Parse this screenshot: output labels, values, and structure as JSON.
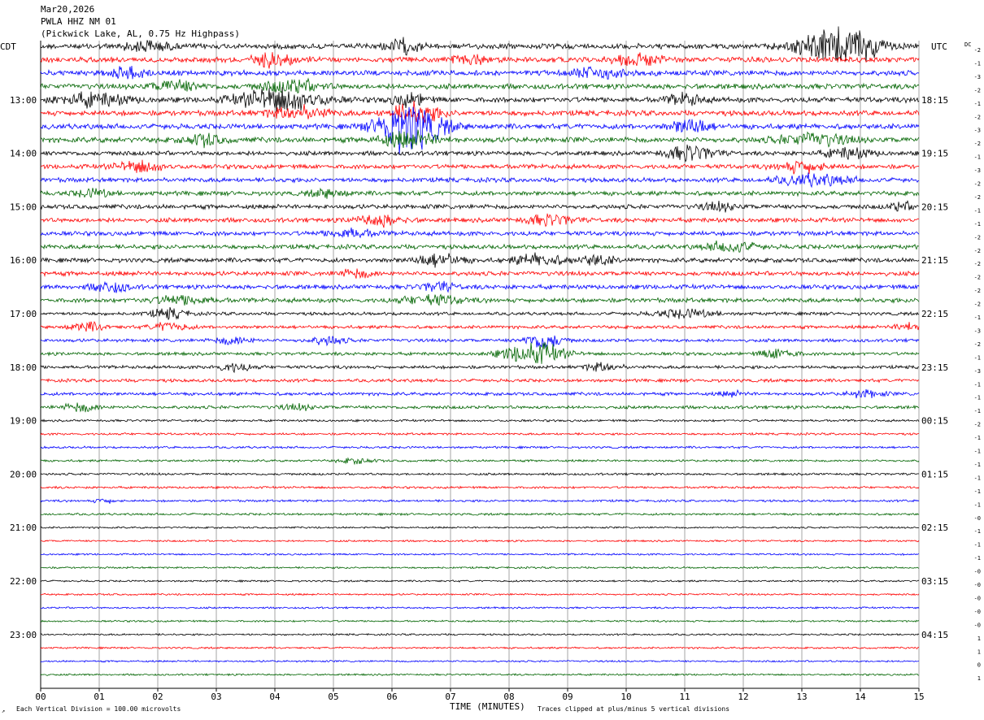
{
  "header": {
    "date": "Mar20,2026",
    "station": "PWLA HHZ NM 01",
    "location": "(Pickwick Lake, AL, 0.75 Hz Highpass)"
  },
  "left_tz": "CDT",
  "right_tz": "UTC",
  "dc_label": "DC",
  "footer": {
    "scale": "Each Vertical Division =  100.00 microvolts",
    "xlabel": "TIME (MINUTES)",
    "clip": "Traces clipped at plus/minus 5 vertical divisions"
  },
  "colors": {
    "trace": [
      "#000000",
      "#ff0000",
      "#0000ff",
      "#006400"
    ],
    "grid": "#808080"
  },
  "chart_data": {
    "type": "line",
    "title": "PWLA HHZ NM 01",
    "xlabel": "TIME (MINUTES)",
    "xlim": [
      0,
      15
    ],
    "x_ticks": [
      "00",
      "01",
      "02",
      "03",
      "04",
      "05",
      "06",
      "07",
      "08",
      "09",
      "10",
      "11",
      "12",
      "13",
      "14",
      "15"
    ],
    "rows_per_hour": 4,
    "row_minutes": 15,
    "left_hour_labels": [
      "13:00",
      "14:00",
      "15:00",
      "16:00",
      "17:00",
      "18:00",
      "19:00",
      "20:00",
      "21:00",
      "22:00",
      "23:00"
    ],
    "right_hour_labels": [
      "18:15",
      "19:15",
      "20:15",
      "21:15",
      "22:15",
      "23:15",
      "00:15",
      "01:15",
      "02:15",
      "03:15",
      "04:15"
    ],
    "dc_offsets": [
      "-2",
      "-1",
      "-3",
      "-2",
      "-1",
      "-2",
      "-3",
      "-2",
      "-1",
      "-3",
      "-2",
      "-2",
      "-1",
      "-1",
      "-2",
      "-2",
      "-2",
      "-2",
      "-2",
      "-2",
      "-1",
      "-3",
      "-2",
      "-1",
      "-3",
      "-1",
      "-1",
      "-1",
      "-2",
      "-1",
      "-1",
      "-1",
      "-1",
      "-1",
      "-1",
      "-0",
      "-1",
      "-1",
      "-1",
      "-0",
      "-0",
      "-0",
      "-0",
      "-0",
      "1",
      "1",
      "0",
      "1"
    ],
    "activity": [
      {
        "row": 0,
        "events": [
          {
            "t": 1.8,
            "a": 1.2,
            "d": 0.4
          },
          {
            "t": 6.2,
            "a": 1.5,
            "d": 0.3
          },
          {
            "t": 13.4,
            "a": 3.5,
            "d": 0.5
          },
          {
            "t": 14.0,
            "a": 3.0,
            "d": 0.4
          }
        ]
      },
      {
        "row": 1,
        "events": [
          {
            "t": 4.0,
            "a": 1.6,
            "d": 0.4
          },
          {
            "t": 7.3,
            "a": 1.2,
            "d": 0.3
          },
          {
            "t": 10.2,
            "a": 1.4,
            "d": 0.4
          }
        ]
      },
      {
        "row": 2,
        "events": [
          {
            "t": 1.5,
            "a": 1.3,
            "d": 0.3
          },
          {
            "t": 9.5,
            "a": 1.3,
            "d": 0.4
          }
        ]
      },
      {
        "row": 3,
        "events": [
          {
            "t": 2.3,
            "a": 1.2,
            "d": 0.4
          },
          {
            "t": 4.3,
            "a": 1.5,
            "d": 0.5
          }
        ]
      },
      {
        "row": 4,
        "events": [
          {
            "t": 0.9,
            "a": 1.5,
            "d": 0.6
          },
          {
            "t": 4.1,
            "a": 2.8,
            "d": 0.7
          },
          {
            "t": 6.3,
            "a": 1.4,
            "d": 0.3
          },
          {
            "t": 11.0,
            "a": 1.3,
            "d": 0.3
          }
        ]
      },
      {
        "row": 5,
        "events": [
          {
            "t": 4.4,
            "a": 1.5,
            "d": 0.5
          },
          {
            "t": 6.4,
            "a": 2.5,
            "d": 0.4
          }
        ]
      },
      {
        "row": 6,
        "events": [
          {
            "t": 6.4,
            "a": 4.5,
            "d": 0.5
          },
          {
            "t": 6.1,
            "a": 2.5,
            "d": 0.4
          },
          {
            "t": 11.1,
            "a": 2.0,
            "d": 0.3
          }
        ]
      },
      {
        "row": 7,
        "events": [
          {
            "t": 2.8,
            "a": 1.4,
            "d": 0.3
          },
          {
            "t": 6.3,
            "a": 1.8,
            "d": 0.5
          },
          {
            "t": 13.2,
            "a": 1.4,
            "d": 0.6
          }
        ]
      },
      {
        "row": 8,
        "events": [
          {
            "t": 11.1,
            "a": 1.8,
            "d": 0.4
          },
          {
            "t": 13.8,
            "a": 1.2,
            "d": 0.4
          }
        ]
      },
      {
        "row": 9,
        "events": [
          {
            "t": 1.7,
            "a": 1.3,
            "d": 0.4
          },
          {
            "t": 13.0,
            "a": 1.4,
            "d": 0.4
          }
        ]
      },
      {
        "row": 10,
        "events": [
          {
            "t": 13.2,
            "a": 1.3,
            "d": 0.6
          }
        ]
      },
      {
        "row": 11,
        "events": [
          {
            "t": 0.9,
            "a": 0.9,
            "d": 0.3
          },
          {
            "t": 4.9,
            "a": 0.9,
            "d": 0.3
          }
        ]
      },
      {
        "row": 12,
        "events": [
          {
            "t": 11.6,
            "a": 0.9,
            "d": 0.3
          },
          {
            "t": 14.7,
            "a": 1.0,
            "d": 0.2
          }
        ]
      },
      {
        "row": 13,
        "events": [
          {
            "t": 5.8,
            "a": 1.3,
            "d": 0.4
          },
          {
            "t": 8.7,
            "a": 1.2,
            "d": 0.4
          }
        ]
      },
      {
        "row": 14,
        "events": [
          {
            "t": 5.3,
            "a": 1.0,
            "d": 0.4
          }
        ]
      },
      {
        "row": 15,
        "events": [
          {
            "t": 11.8,
            "a": 1.3,
            "d": 0.4
          }
        ]
      },
      {
        "row": 16,
        "events": [
          {
            "t": 6.8,
            "a": 1.4,
            "d": 0.4
          },
          {
            "t": 8.5,
            "a": 1.4,
            "d": 0.4
          },
          {
            "t": 9.5,
            "a": 1.2,
            "d": 0.3
          }
        ]
      },
      {
        "row": 17,
        "events": [
          {
            "t": 5.4,
            "a": 0.9,
            "d": 0.3
          }
        ]
      },
      {
        "row": 18,
        "events": [
          {
            "t": 1.2,
            "a": 1.2,
            "d": 0.3
          },
          {
            "t": 6.8,
            "a": 1.0,
            "d": 0.3
          }
        ]
      },
      {
        "row": 19,
        "events": [
          {
            "t": 2.4,
            "a": 1.0,
            "d": 0.5
          },
          {
            "t": 6.7,
            "a": 1.1,
            "d": 0.5
          }
        ]
      },
      {
        "row": 20,
        "events": [
          {
            "t": 2.2,
            "a": 1.2,
            "d": 0.3
          },
          {
            "t": 11.0,
            "a": 1.0,
            "d": 0.5
          }
        ]
      },
      {
        "row": 21,
        "events": [
          {
            "t": 0.8,
            "a": 1.0,
            "d": 0.3
          },
          {
            "t": 2.2,
            "a": 1.1,
            "d": 0.3
          },
          {
            "t": 14.8,
            "a": 1.0,
            "d": 0.2
          }
        ]
      },
      {
        "row": 22,
        "events": [
          {
            "t": 3.3,
            "a": 1.0,
            "d": 0.3
          },
          {
            "t": 4.9,
            "a": 1.0,
            "d": 0.3
          },
          {
            "t": 8.6,
            "a": 2.0,
            "d": 0.3
          }
        ]
      },
      {
        "row": 23,
        "events": [
          {
            "t": 8.2,
            "a": 1.5,
            "d": 0.4
          },
          {
            "t": 8.6,
            "a": 1.8,
            "d": 0.4
          },
          {
            "t": 12.6,
            "a": 1.2,
            "d": 0.3
          }
        ]
      },
      {
        "row": 24,
        "events": [
          {
            "t": 3.3,
            "a": 1.0,
            "d": 0.3
          },
          {
            "t": 9.6,
            "a": 1.0,
            "d": 0.3
          }
        ]
      },
      {
        "row": 26,
        "events": [
          {
            "t": 14.1,
            "a": 0.9,
            "d": 0.3
          },
          {
            "t": 11.8,
            "a": 0.6,
            "d": 0.2
          }
        ]
      },
      {
        "row": 27,
        "events": [
          {
            "t": 0.7,
            "a": 1.0,
            "d": 0.3
          },
          {
            "t": 4.4,
            "a": 0.6,
            "d": 0.3
          }
        ]
      },
      {
        "row": 31,
        "events": [
          {
            "t": 5.4,
            "a": 0.6,
            "d": 0.3
          }
        ]
      },
      {
        "row": 34,
        "events": [
          {
            "t": 1.1,
            "a": 0.5,
            "d": 0.2
          }
        ]
      }
    ]
  }
}
